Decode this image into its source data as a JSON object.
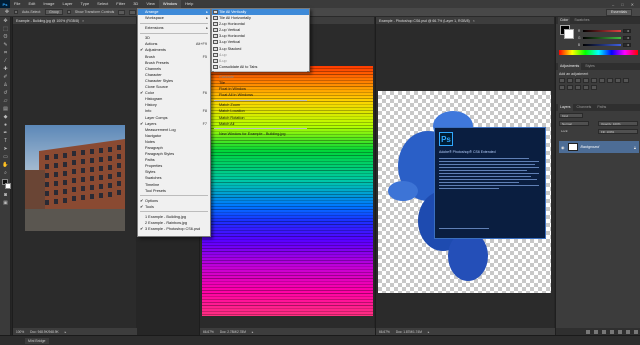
{
  "app": {
    "logo": "Ps"
  },
  "menubar": {
    "items": [
      "File",
      "Edit",
      "Image",
      "Layer",
      "Type",
      "Select",
      "Filter",
      "3D",
      "View",
      "Window",
      "Help"
    ],
    "active_index": 9,
    "window_controls": [
      "–",
      "□",
      "✕"
    ]
  },
  "options": {
    "auto_select": "Auto-Select:",
    "group": "Group",
    "show_transform": "Show Transform Controls",
    "workspace": "Essentials"
  },
  "documents": [
    {
      "tab": "Example - Building.jpg @ 100% (RGB/8)",
      "zoom": "100%",
      "doc": "Doc: 948.9K/948.9K"
    },
    {
      "tab": "Example - Rainbow.jpg @ 66.7% (RGB/8)",
      "zoom": "66.67%",
      "doc": "Doc: 2.78M/2.78M"
    },
    {
      "tab": "Example - Photoshop CS6.psd @ 66.7% (Layer 1, RGB/8)",
      "zoom": "66.67%",
      "doc": "Doc: 1.87M/1.74M"
    }
  ],
  "window_menu": {
    "items": [
      {
        "label": "Arrange",
        "arrow": true,
        "highlight": true
      },
      {
        "label": "Workspace",
        "arrow": true
      },
      {
        "sep": true
      },
      {
        "label": "Extensions",
        "arrow": true
      },
      {
        "sep": true
      },
      {
        "label": "3D"
      },
      {
        "label": "Actions",
        "shortcut": "Alt+F9"
      },
      {
        "label": "Adjustments",
        "check": true
      },
      {
        "label": "Brush",
        "shortcut": "F5"
      },
      {
        "label": "Brush Presets"
      },
      {
        "label": "Channels"
      },
      {
        "label": "Character"
      },
      {
        "label": "Character Styles"
      },
      {
        "label": "Clone Source"
      },
      {
        "label": "Color",
        "shortcut": "F6",
        "check": true
      },
      {
        "label": "Histogram"
      },
      {
        "label": "History"
      },
      {
        "label": "Info",
        "shortcut": "F8"
      },
      {
        "label": "Layer Comps"
      },
      {
        "label": "Layers",
        "shortcut": "F7",
        "check": true
      },
      {
        "label": "Measurement Log"
      },
      {
        "label": "Navigator"
      },
      {
        "label": "Notes"
      },
      {
        "label": "Paragraph"
      },
      {
        "label": "Paragraph Styles"
      },
      {
        "label": "Paths"
      },
      {
        "label": "Properties"
      },
      {
        "label": "Styles"
      },
      {
        "label": "Swatches"
      },
      {
        "label": "Timeline"
      },
      {
        "label": "Tool Presets"
      },
      {
        "sep": true
      },
      {
        "label": "Options",
        "check": true
      },
      {
        "label": "Tools",
        "check": true
      },
      {
        "sep": true
      },
      {
        "label": "1 Example - Building.jpg"
      },
      {
        "label": "2 Example - Rainbow.jpg"
      },
      {
        "label": "3 Example - Photoshop CS6.psd",
        "check": true
      }
    ]
  },
  "arrange_menu": {
    "items": [
      {
        "label": "Tile All Vertically",
        "highlight": true,
        "icon": true
      },
      {
        "label": "Tile All Horizontally",
        "icon": true
      },
      {
        "label": "2-up Horizontal",
        "icon": true
      },
      {
        "label": "2-up Vertical",
        "icon": true
      },
      {
        "label": "3-up Horizontal",
        "icon": true
      },
      {
        "label": "3-up Vertical",
        "icon": true
      },
      {
        "label": "3-up Stacked",
        "icon": true
      },
      {
        "label": "4-up",
        "icon": true,
        "disabled": true
      },
      {
        "label": "6-up",
        "icon": true,
        "disabled": true
      },
      {
        "label": "Consolidate All to Tabs",
        "icon": true
      },
      {
        "sep": true
      },
      {
        "label": "Cascade",
        "disabled": true
      },
      {
        "label": "Tile"
      },
      {
        "label": "Float in Window"
      },
      {
        "label": "Float All in Windows"
      },
      {
        "sep": true
      },
      {
        "label": "Match Zoom"
      },
      {
        "label": "Match Location"
      },
      {
        "label": "Match Rotation"
      },
      {
        "label": "Match All"
      },
      {
        "sep": true
      },
      {
        "label": "New Window for Example - Building.jpg"
      }
    ]
  },
  "splash": {
    "logo": "Ps",
    "title": "Adobe® Photoshop® CS6 Extended"
  },
  "right_panel": {
    "color_tabs": [
      "Color",
      "Swatches"
    ],
    "sliders": [
      {
        "label": "R",
        "value": "0",
        "color": "#e04040"
      },
      {
        "label": "G",
        "value": "0",
        "color": "#40c040"
      },
      {
        "label": "B",
        "value": "0",
        "color": "#4060e0"
      }
    ],
    "adj_tabs": [
      "Adjustments",
      "Styles"
    ],
    "adj_title": "Add an adjustment",
    "layer_tabs": [
      "Layers",
      "Channels",
      "Paths"
    ],
    "kind": "Kind",
    "blend": "Normal",
    "opacity": "Opacity: 100%",
    "lock": "Lock:",
    "fill": "Fill: 100%",
    "layer_name": "Background"
  },
  "bottom": {
    "mini_bridge": "Mini Bridge"
  }
}
